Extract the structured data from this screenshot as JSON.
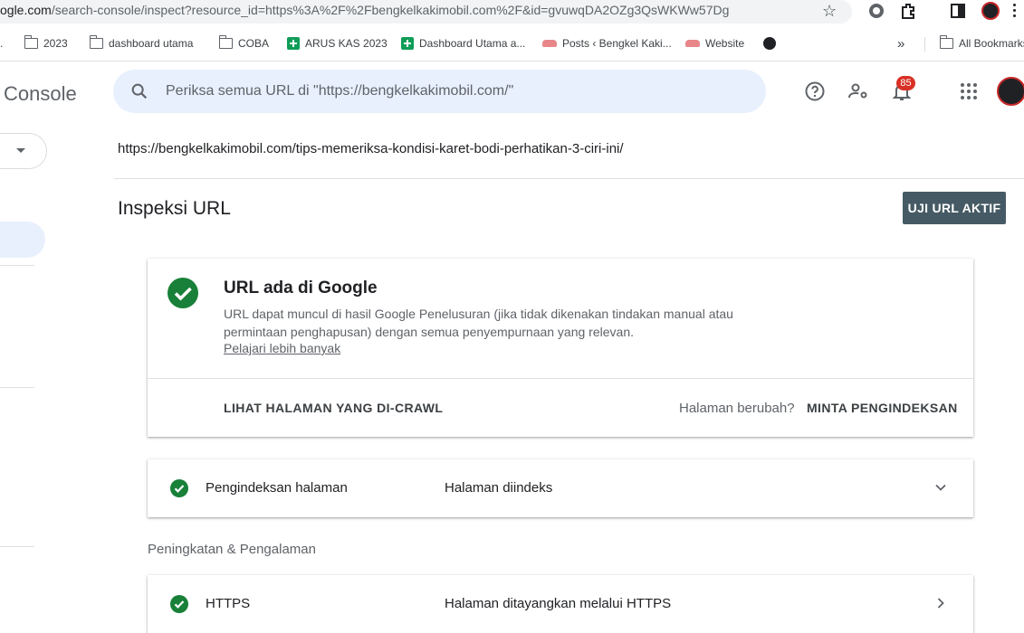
{
  "browser": {
    "url_prefix": "ogle.com",
    "url_rest": "/search-console/inspect?resource_id=https%3A%2F%2Fbengkelkakimobil.com%2F&id=gvuwqDA2OZg3QsWKWw57Dg",
    "bookmarks": [
      {
        "label": "2023",
        "icon": "folder-icon"
      },
      {
        "label": "dashboard utama",
        "icon": "folder-icon"
      },
      {
        "label": "COBA",
        "icon": "folder-icon"
      },
      {
        "label": "ARUS KAS 2023",
        "icon": "sheets-icon"
      },
      {
        "label": "Dashboard Utama a...",
        "icon": "sheets-icon"
      },
      {
        "label": "Posts ‹ Bengkel Kaki...",
        "icon": "car-icon"
      },
      {
        "label": "Website",
        "icon": "car-icon"
      }
    ],
    "all_bookmarks": "All Bookmarks",
    "more": "»"
  },
  "header": {
    "brand": "Console",
    "search_placeholder": "Periksa semua URL di \"https://bengkelkakimobil.com/\"",
    "notifications_count": "85"
  },
  "main": {
    "inspected_url": "https://bengkelkakimobil.com/tips-memeriksa-kondisi-karet-bodi-perhatikan-3-ciri-ini/",
    "title": "Inspeksi URL",
    "test_live_button": "UJI URL AKTIF",
    "status_card": {
      "title": "URL ada di Google",
      "description": "URL dapat muncul di hasil Google Penelusuran (jika tidak dikenakan tindakan manual atau permintaan penghapusan) dengan semua penyempurnaan yang relevan.",
      "learn_more": "Pelajari lebih banyak",
      "view_crawled": "LIHAT HALAMAN YANG DI-CRAWL",
      "page_changed": "Halaman berubah?",
      "request_indexing": "MINTA PENGINDEKSAN"
    },
    "indexing_row": {
      "label": "Pengindeksan halaman",
      "status": "Halaman diindeks"
    },
    "section_title": "Peningkatan & Pengalaman",
    "https_row": {
      "label": "HTTPS",
      "status": "Halaman ditayangkan melalui HTTPS"
    }
  },
  "colors": {
    "success": "#188038",
    "accent_bg": "#e8f0fe",
    "button": "#455a64",
    "badge": "#d93025"
  }
}
